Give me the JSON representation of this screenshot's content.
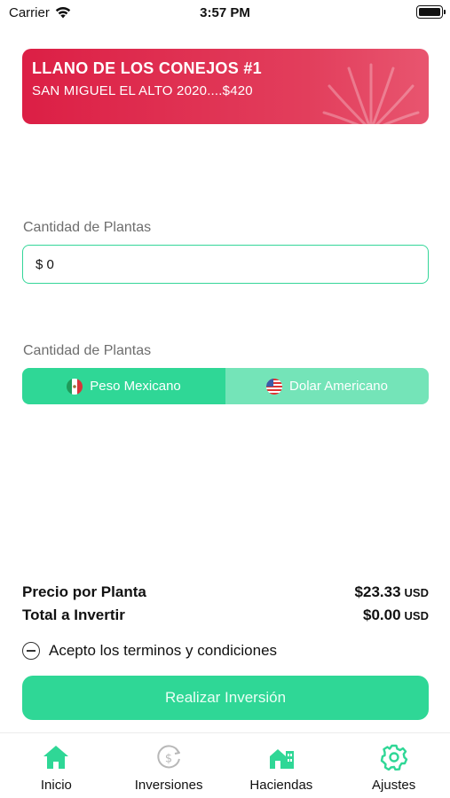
{
  "status_bar": {
    "carrier": "Carrier",
    "time": "3:57 PM",
    "icons": [
      "wifi-icon",
      "battery-icon"
    ]
  },
  "banner": {
    "title": "LLANO DE LOS CONEJOS #1",
    "subtitle": "SAN MIGUEL EL ALTO 2020....$420",
    "icon": "agave-icon",
    "color": "#dc1f45"
  },
  "form": {
    "amount_label": "Cantidad de Plantas",
    "amount_value": "$ 0",
    "currency_label": "Cantidad de Plantas",
    "currency_options": [
      {
        "label": "Peso Mexicano",
        "icon": "mexico-flag-icon",
        "selected": true
      },
      {
        "label": "Dolar Americano",
        "icon": "usa-flag-icon",
        "selected": false
      }
    ]
  },
  "summary": {
    "price_label": "Precio por Planta",
    "price_value": "$23.33",
    "price_unit": "USD",
    "total_label": "Total a Invertir",
    "total_value": "$0.00",
    "total_unit": "USD"
  },
  "terms": {
    "label": "Acepto los terminos y condiciones",
    "checked": false
  },
  "action": {
    "label": "Realizar Inversión"
  },
  "tabs": [
    {
      "label": "Inicio",
      "icon": "home-icon",
      "active": true
    },
    {
      "label": "Inversiones",
      "icon": "money-cycle-icon",
      "active": false
    },
    {
      "label": "Haciendas",
      "icon": "hacienda-icon",
      "active": false
    },
    {
      "label": "Ajustes",
      "icon": "gear-icon",
      "active": false
    }
  ],
  "colors": {
    "accent": "#2fd796",
    "accent_light": "#74e4b8",
    "banner": "#dc1f45",
    "inactive_icon": "#b8b8b8"
  }
}
